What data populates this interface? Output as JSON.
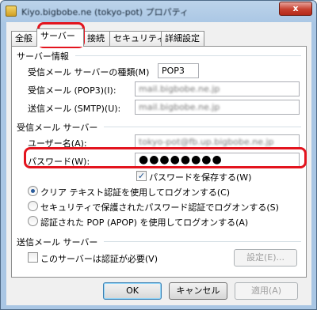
{
  "window": {
    "title": "Kiyo.bigbobe.ne (tokyo-pot) プロパティ",
    "close_glyph": "x"
  },
  "tabs": [
    {
      "label": "全般"
    },
    {
      "label": "サーバー"
    },
    {
      "label": "接続"
    },
    {
      "label": "セキュリティ"
    },
    {
      "label": "詳細設定"
    }
  ],
  "server_info": {
    "heading": "サーバー情報",
    "incoming_type_label": "受信メール サーバーの種類(M)",
    "incoming_type_value": "POP3",
    "incoming_server_label": "受信メール (POP3)(I):",
    "incoming_server_value": "mail.bigbobe.ne.jp",
    "outgoing_server_label": "送信メール (SMTP)(U):",
    "outgoing_server_value": "mail.bigbobe.ne.jp"
  },
  "incoming_server": {
    "heading": "受信メール サーバー",
    "username_label": "ユーザー名(A):",
    "username_value": "tokyo-pot@fb.up.bigbobe.ne.jp",
    "password_label": "パスワード(W):",
    "password_value": "●●●●●●●●",
    "remember_password_label": "パスワードを保存する(W)",
    "remember_password_checked": true,
    "auth_options": [
      {
        "label": "クリア テキスト認証を使用してログオンする(C)",
        "checked": true
      },
      {
        "label": "セキュリティで保護されたパスワード認証でログオンする(S)",
        "checked": false
      },
      {
        "label": "認証された POP (APOP) を使用してログオンする(A)",
        "checked": false
      }
    ]
  },
  "outgoing_server": {
    "heading": "送信メール サーバー",
    "requires_auth_label": "このサーバーは認証が必要(V)",
    "requires_auth_checked": false,
    "settings_button": "設定(E)..."
  },
  "footer": {
    "ok": "OK",
    "cancel": "キャンセル",
    "apply": "適用(A)"
  },
  "colors": {
    "highlight": "#e3141e",
    "accent": "#2a5c9c"
  }
}
